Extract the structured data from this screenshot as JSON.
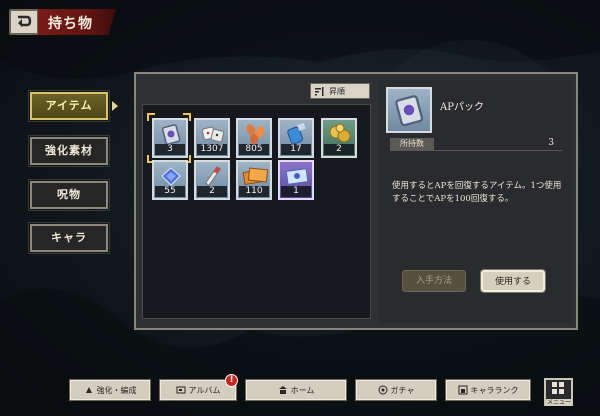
{
  "header": {
    "title": "持ち物"
  },
  "side_tabs": [
    {
      "label": "アイテム",
      "active": true
    },
    {
      "label": "強化素材",
      "active": false
    },
    {
      "label": "呪物",
      "active": false
    },
    {
      "label": "キャラ",
      "active": false
    }
  ],
  "sort_button": {
    "label": "昇順"
  },
  "items": [
    {
      "count": "3",
      "icon": "ap-pack-icon",
      "rarity": "normal",
      "selected": true
    },
    {
      "count": "1307",
      "icon": "dice-icon",
      "rarity": "normal",
      "selected": false
    },
    {
      "count": "805",
      "icon": "petals-icon",
      "rarity": "normal",
      "selected": false
    },
    {
      "count": "17",
      "icon": "potion-icon",
      "rarity": "normal",
      "selected": false
    },
    {
      "count": "2",
      "icon": "gold-coins-icon",
      "rarity": "rare",
      "selected": false
    },
    {
      "count": "55",
      "icon": "gem-icon",
      "rarity": "normal",
      "selected": false
    },
    {
      "count": "2",
      "icon": "crystal-wand-icon",
      "rarity": "normal",
      "selected": false
    },
    {
      "count": "110",
      "icon": "orange-ticket-icon",
      "rarity": "normal",
      "selected": false
    },
    {
      "count": "1",
      "icon": "blue-ticket-icon",
      "rarity": "epic",
      "selected": false
    }
  ],
  "detail": {
    "name": "APパック",
    "quantity_label": "所持数",
    "quantity": "3",
    "description": "使用するとAPを回復するアイテム。1つ使用することでAPを100回復する。",
    "obtain_button": "入手方法",
    "use_button": "使用する"
  },
  "bottom_nav": [
    {
      "label": "強化・編成",
      "icon": "enhance-icon"
    },
    {
      "label": "アルバム",
      "icon": "album-icon",
      "alert": "!"
    },
    {
      "label": "ホーム",
      "icon": "home-icon"
    },
    {
      "label": "ガチャ",
      "icon": "gacha-icon"
    },
    {
      "label": "キャラランク",
      "icon": "ranking-icon"
    }
  ],
  "menu_button": {
    "label": "メニュー"
  },
  "colors": {
    "accent_gold": "#f0c743",
    "title_red": "#7a1b17",
    "panel_bg": "#2f3033",
    "button_cream": "#d3cebf"
  }
}
